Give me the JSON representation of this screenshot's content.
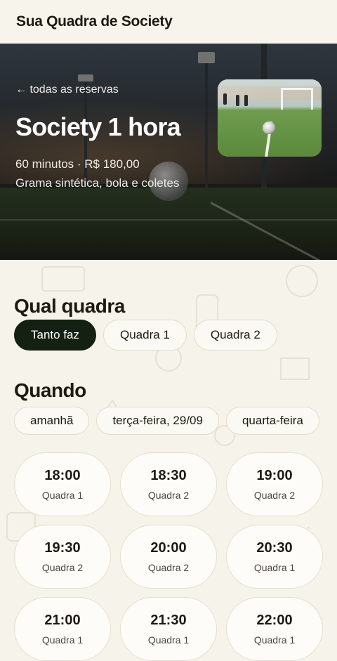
{
  "header": {
    "brand": "Sua Quadra de Society"
  },
  "hero": {
    "back_link": "← todas as reservas",
    "title": "Society 1 hora",
    "meta": "60 minutos · R$ 180,00",
    "description": "Grama sintética, bola e coletes"
  },
  "court_section": {
    "title": "Qual quadra",
    "options": [
      {
        "label": "Tanto faz",
        "selected": true
      },
      {
        "label": "Quadra 1",
        "selected": false
      },
      {
        "label": "Quadra 2",
        "selected": false
      }
    ]
  },
  "date_section": {
    "title": "Quando",
    "dates": [
      "amanhã",
      "terça-feira, 29/09",
      "quarta-feira"
    ]
  },
  "slots": [
    {
      "time": "18:00",
      "court": "Quadra 1"
    },
    {
      "time": "18:30",
      "court": "Quadra 2"
    },
    {
      "time": "19:00",
      "court": "Quadra 2"
    },
    {
      "time": "19:30",
      "court": "Quadra 2"
    },
    {
      "time": "20:00",
      "court": "Quadra 2"
    },
    {
      "time": "20:30",
      "court": "Quadra 1"
    },
    {
      "time": "21:00",
      "court": "Quadra 1"
    },
    {
      "time": "21:30",
      "court": "Quadra 1"
    },
    {
      "time": "22:00",
      "court": "Quadra 1"
    }
  ],
  "colors": {
    "accent": "#132012",
    "background": "#f6f3ea"
  }
}
